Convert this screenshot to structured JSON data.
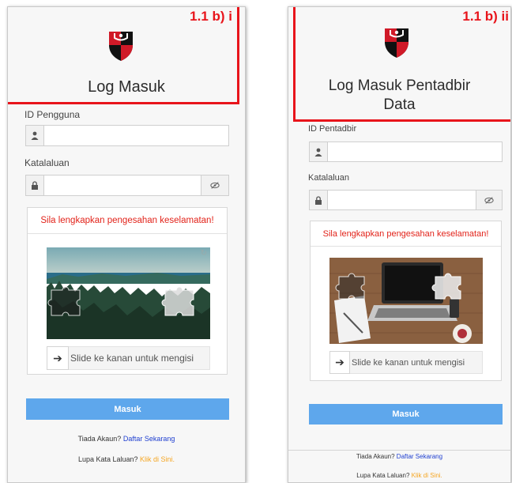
{
  "panels": [
    {
      "annotation": "1.1 b) i",
      "title_lines": [
        "Log Masuk"
      ],
      "id_label": "ID Pengguna",
      "password_label": "Katalaluan",
      "captcha_message": "Sila lengkapkan pengesahan keselamatan!",
      "slider_text": "Slide ke kanan untuk mengisi",
      "submit_label": "Masuk",
      "no_account_text": "Tiada Akaun?",
      "register_link": "Daftar Sekarang",
      "forgot_text": "Lupa Kata Laluan?",
      "forgot_link": "Klik di Sini."
    },
    {
      "annotation": "1.1 b) ii",
      "title_lines": [
        "Log Masuk Pentadbir",
        "Data"
      ],
      "id_label": "ID Pentadbir",
      "password_label": "Katalaluan",
      "captcha_message": "Sila lengkapkan pengesahan keselamatan!",
      "slider_text": "Slide ke kanan untuk mengisi",
      "submit_label": "Masuk",
      "no_account_text": "Tiada Akaun?",
      "register_link": "Daftar Sekarang",
      "forgot_text": "Lupa Kata Laluan?",
      "forgot_link": "Klik di Sini."
    }
  ],
  "icons": {
    "logo": "shield-crest-icon",
    "id_field": "user-icon",
    "password_field": "lock-icon",
    "password_toggle": "eye-slash-icon",
    "slider": "arrow-right-icon",
    "captcha_refresh": "refresh-icon"
  },
  "colors": {
    "annotation": "#e8141b",
    "captcha_message": "#e2231a",
    "button": "#5ea7ec",
    "register_link": "#1f3fd0",
    "forgot_link": "#f5a623",
    "shield_red": "#d01a28",
    "shield_black": "#111111"
  }
}
